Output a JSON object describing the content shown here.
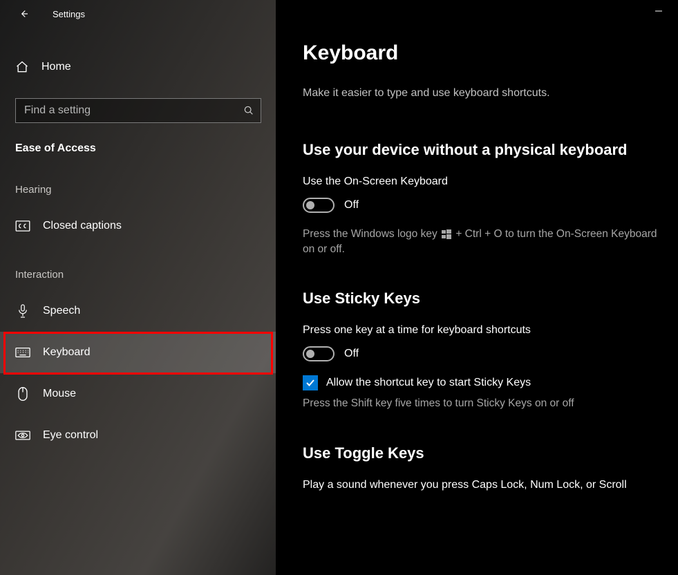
{
  "window": {
    "title": "Settings"
  },
  "sidebar": {
    "home": "Home",
    "search_placeholder": "Find a setting",
    "category": "Ease of Access",
    "groups": {
      "hearing": "Hearing",
      "interaction": "Interaction"
    },
    "items": {
      "closed_captions": "Closed captions",
      "speech": "Speech",
      "keyboard": "Keyboard",
      "mouse": "Mouse",
      "eye_control": "Eye control"
    }
  },
  "content": {
    "title": "Keyboard",
    "subtitle": "Make it easier to type and use keyboard shortcuts.",
    "section1": {
      "heading": "Use your device without a physical keyboard",
      "label": "Use the On-Screen Keyboard",
      "state": "Off",
      "hint_pre": "Press the Windows logo key ",
      "hint_post": " + Ctrl + O to turn the On-Screen Keyboard on or off."
    },
    "section2": {
      "heading": "Use Sticky Keys",
      "label": "Press one key at a time for keyboard shortcuts",
      "state": "Off",
      "checkbox": "Allow the shortcut key to start Sticky Keys",
      "hint": "Press the Shift key five times to turn Sticky Keys on or off"
    },
    "section3": {
      "heading": "Use Toggle Keys",
      "label": "Play a sound whenever you press Caps Lock, Num Lock, or Scroll"
    }
  }
}
